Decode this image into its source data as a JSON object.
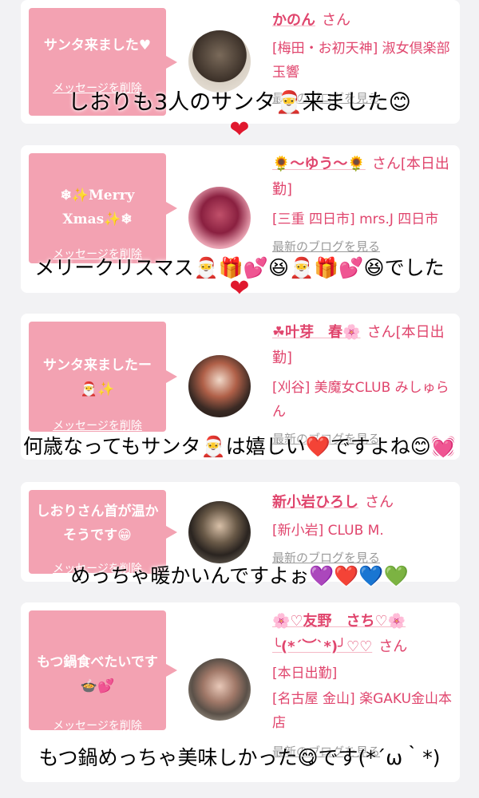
{
  "cards": [
    {
      "bubble_message": "サンタ来ました♥",
      "delete_link": "メッセージを削除",
      "user_name": "かのん",
      "honorific": "さん",
      "shop": "[梅田・お初天神] 淑女倶楽部 玉響",
      "blog_link": "最新のブログを見る"
    },
    {
      "bubble_message": "❄✨Merry Xmas✨❄",
      "delete_link": "メッセージを削除",
      "user_name": "🌻〜ゆう〜🌻",
      "honorific": "さん",
      "status": "[本日出勤]",
      "shop": "[三重 四日市] mrs.J 四日市",
      "blog_link": "最新のブログを見る"
    },
    {
      "bubble_message": "サンタ来ましたー🎅✨",
      "delete_link": "メッセージを削除",
      "user_name": "☘叶芽　春🌸",
      "honorific": "さん",
      "status": "[本日出勤]",
      "shop": "[刈谷] 美魔女CLUB みしゅらん",
      "blog_link": "最新のブログを見る"
    },
    {
      "bubble_message": "しおりさん首が温かそうです😁",
      "delete_link": "メッセージを削除",
      "user_name": "新小岩ひろし",
      "honorific": "さん",
      "shop": "[新小岩] CLUB M.",
      "blog_link": "最新のブログを見る"
    },
    {
      "bubble_message": "もつ鍋食べたいです🍲💕",
      "delete_link": "メッセージを削除",
      "user_name": "🌸♡友野　さち♡🌸",
      "user_name_line2": "╰(*´︶`*)╯♡♡",
      "honorific": "さん",
      "status": "[本日出勤]",
      "shop": "[名古屋 金山] 楽GAKU金山本店",
      "blog_link": "最新のブログを見る"
    }
  ],
  "overlays": [
    "しおりも3人のサンタ🎅来ました😊",
    "メリークリスマス🎅🎁💕😆🎅🎁💕😆でした",
    "何歳なってもサンタ🎅は嬉しい❤️ですよね😊💓",
    "めっちゃ暖かいんですよぉ💜❤️💙💚",
    "もつ鍋めっちゃ美味しかった😋です(*´ω｀*)"
  ],
  "overlay_hearts": [
    "❤",
    "❤"
  ],
  "colors": {
    "background": "#f2f2f4",
    "bubble": "#f3a2b2",
    "accent_pink": "#e0456d",
    "card": "#ffffff"
  }
}
